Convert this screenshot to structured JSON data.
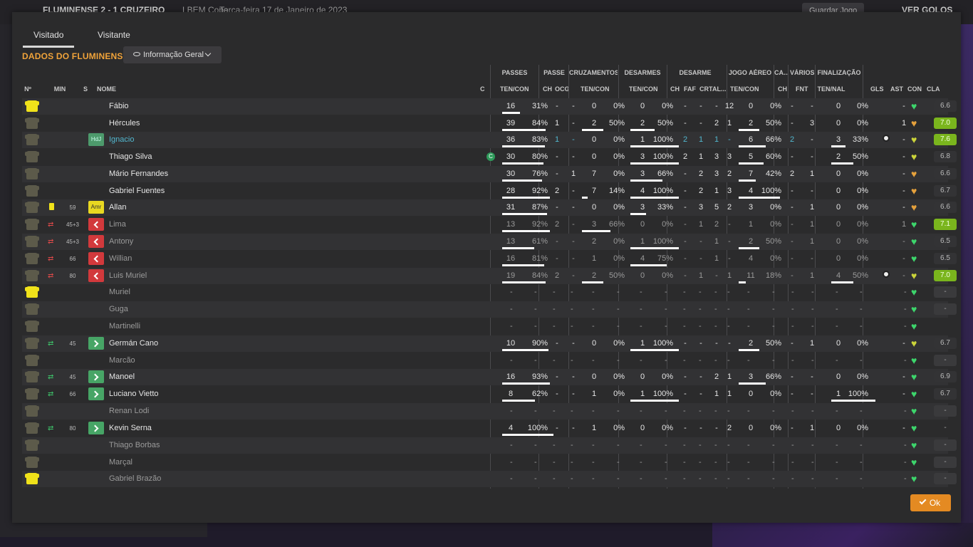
{
  "background": {
    "match": "FLUMINENSE 2 - 1 CRUZEIRO",
    "competition": "LBEM Copa",
    "date": "Terça-feira 17 de Janeiro de 2023",
    "save_label": "Guardar Jogo",
    "goals_label": "VER GOLOS"
  },
  "tabs": [
    "Visitado",
    "Visitante"
  ],
  "title": "DADOS DO FLUMINENSE",
  "dropdown": "Informação Geral",
  "groups": [
    "PASSES",
    "PASSE",
    "CRUZAMENTOS",
    "DESARMES",
    "DESARME",
    "JOGO AÉREO",
    "CA...",
    "VÁRIOS",
    "FINALIZAÇÃO"
  ],
  "subheaders": [
    "Nº",
    "MIN",
    "S",
    "NOME",
    "C",
    "TEN/CON",
    "CH",
    "OCG",
    "TEN/CON",
    "TEN/CON",
    "CH",
    "FAF",
    "CRT",
    "AL...",
    "TEN/CON",
    "CH",
    "FNT",
    "TEN/NAL",
    "GLS",
    "AST",
    "CON",
    "CLA"
  ],
  "ok_label": "Ok",
  "colors": {
    "accent": "#f0a33a",
    "ok": "#e48a22",
    "rating_good": "#7ab51d",
    "sub_out": "#d2393c",
    "sub_in": "#47a566"
  },
  "players": [
    {
      "name": "Fábio",
      "gk": true,
      "card": "",
      "sub": "",
      "min": "",
      "badge": "",
      "cap": "",
      "pass": [
        "16",
        "31%"
      ],
      "pbar": 0.31,
      "ch": "-",
      "ocg": "-",
      "cruz": [
        "0",
        "0%"
      ],
      "cbar": 0,
      "des": [
        "0",
        "0%"
      ],
      "dbar": 0,
      "d": [
        "-",
        "-",
        "-",
        "12"
      ],
      "aer": [
        "0",
        "0%"
      ],
      "abar": 0,
      "ca": "-",
      "fnt": "-",
      "fin": [
        "0",
        "0%"
      ],
      "fbar": 0,
      "gls": "",
      "ast": "-",
      "con": "green",
      "cla": "6.6",
      "clac": "gt",
      "dim": false
    },
    {
      "name": "Hércules",
      "gk": false,
      "card": "",
      "sub": "",
      "min": "",
      "badge": "",
      "cap": "",
      "pass": [
        "39",
        "84%"
      ],
      "pbar": 0.84,
      "ch": "1",
      "ocg": "-",
      "cruz": [
        "2",
        "50%"
      ],
      "cbar": 0.5,
      "des": [
        "2",
        "50%"
      ],
      "dbar": 0.5,
      "d": [
        "-",
        "-",
        "2",
        "1"
      ],
      "aer": [
        "2",
        "50%"
      ],
      "abar": 0.5,
      "ca": "-",
      "fnt": "3",
      "fin": [
        "0",
        "0%"
      ],
      "fbar": 0,
      "gls": "",
      "ast": "1",
      "con": "orange",
      "cla": "7.0",
      "clac": "g",
      "dim": false
    },
    {
      "name": "Ignacio",
      "gk": false,
      "card": "",
      "sub": "",
      "min": "",
      "badge": "HdJ",
      "cap": "",
      "pass": [
        "36",
        "83%"
      ],
      "pbar": 0.83,
      "ch": "1",
      "ocg": "-",
      "cruz": [
        "0",
        "0%"
      ],
      "cbar": 0,
      "des": [
        "1",
        "100%"
      ],
      "dbar": 1,
      "d": [
        "2",
        "1",
        "1",
        "-"
      ],
      "aer": [
        "6",
        "66%"
      ],
      "abar": 0.66,
      "ca": "2",
      "fnt": "-",
      "fin": [
        "3",
        "33%"
      ],
      "fbar": 0.33,
      "gls": "ball",
      "ast": "-",
      "con": "yellow",
      "cla": "7.6",
      "clac": "g",
      "dim": false,
      "hl": true
    },
    {
      "name": "Thiago Silva",
      "gk": false,
      "card": "",
      "sub": "",
      "min": "",
      "badge": "",
      "cap": "C",
      "pass": [
        "30",
        "80%"
      ],
      "pbar": 0.8,
      "ch": "-",
      "ocg": "-",
      "cruz": [
        "0",
        "0%"
      ],
      "cbar": 0,
      "des": [
        "3",
        "100%"
      ],
      "dbar": 1,
      "d": [
        "2",
        "1",
        "3",
        "3"
      ],
      "aer": [
        "5",
        "60%"
      ],
      "abar": 0.6,
      "ca": "-",
      "fnt": "-",
      "fin": [
        "2",
        "50%"
      ],
      "fbar": 0.5,
      "gls": "",
      "ast": "-",
      "con": "yellow",
      "cla": "6.8",
      "clac": "gt",
      "dim": false
    },
    {
      "name": "Mário Fernandes",
      "gk": false,
      "card": "",
      "sub": "",
      "min": "",
      "badge": "",
      "cap": "",
      "pass": [
        "30",
        "76%"
      ],
      "pbar": 0.76,
      "ch": "-",
      "ocg": "1",
      "cruz": [
        "7",
        "0%"
      ],
      "cbar": 0,
      "des": [
        "3",
        "66%"
      ],
      "dbar": 0.66,
      "d": [
        "-",
        "2",
        "3",
        "2"
      ],
      "aer": [
        "7",
        "42%"
      ],
      "abar": 0.42,
      "ca": "2",
      "fnt": "1",
      "fin": [
        "0",
        "0%"
      ],
      "fbar": 0,
      "gls": "",
      "ast": "-",
      "con": "orange",
      "cla": "6.6",
      "clac": "gt",
      "dim": false
    },
    {
      "name": "Gabriel Fuentes",
      "gk": false,
      "card": "",
      "sub": "",
      "min": "",
      "badge": "",
      "cap": "",
      "pass": [
        "28",
        "92%"
      ],
      "pbar": 0.92,
      "ch": "2",
      "ocg": "-",
      "cruz": [
        "7",
        "14%"
      ],
      "cbar": 0.14,
      "des": [
        "4",
        "100%"
      ],
      "dbar": 1,
      "d": [
        "-",
        "2",
        "1",
        "3"
      ],
      "aer": [
        "4",
        "100%"
      ],
      "abar": 1,
      "ca": "-",
      "fnt": "-",
      "fin": [
        "0",
        "0%"
      ],
      "fbar": 0,
      "gls": "",
      "ast": "-",
      "con": "orange",
      "cla": "6.7",
      "clac": "gt",
      "dim": false
    },
    {
      "name": "Allan",
      "gk": false,
      "card": "yellow",
      "sub": "",
      "min": "59",
      "badge": "Amr",
      "cap": "",
      "pass": [
        "31",
        "87%"
      ],
      "pbar": 0.87,
      "ch": "-",
      "ocg": "-",
      "cruz": [
        "0",
        "0%"
      ],
      "cbar": 0,
      "des": [
        "3",
        "33%"
      ],
      "dbar": 0.33,
      "d": [
        "-",
        "3",
        "5",
        "2"
      ],
      "aer": [
        "3",
        "0%"
      ],
      "abar": 0,
      "ca": "-",
      "fnt": "1",
      "fin": [
        "0",
        "0%"
      ],
      "fbar": 0,
      "gls": "",
      "ast": "-",
      "con": "orange",
      "cla": "6.6",
      "clac": "gt",
      "dim": false
    },
    {
      "name": "Lima",
      "gk": false,
      "card": "",
      "sub": "out",
      "min": "45+3",
      "badge": "out",
      "cap": "",
      "pass": [
        "13",
        "92%"
      ],
      "pbar": 0.92,
      "ch": "2",
      "ocg": "-",
      "cruz": [
        "3",
        "66%"
      ],
      "cbar": 0.66,
      "des": [
        "0",
        "0%"
      ],
      "dbar": 0,
      "d": [
        "-",
        "1",
        "2",
        "-"
      ],
      "aer": [
        "1",
        "0%"
      ],
      "abar": 0,
      "ca": "-",
      "fnt": "1",
      "fin": [
        "0",
        "0%"
      ],
      "fbar": 0,
      "gls": "",
      "ast": "1",
      "con": "green",
      "cla": "7.1",
      "clac": "g",
      "dim": true
    },
    {
      "name": "Antony",
      "gk": false,
      "card": "",
      "sub": "out",
      "min": "45+3",
      "badge": "out",
      "cap": "",
      "pass": [
        "13",
        "61%"
      ],
      "pbar": 0.61,
      "ch": "-",
      "ocg": "-",
      "cruz": [
        "2",
        "0%"
      ],
      "cbar": 0,
      "des": [
        "1",
        "100%"
      ],
      "dbar": 1,
      "d": [
        "-",
        "-",
        "1",
        "-"
      ],
      "aer": [
        "2",
        "50%"
      ],
      "abar": 0.5,
      "ca": "-",
      "fnt": "1",
      "fin": [
        "0",
        "0%"
      ],
      "fbar": 0,
      "gls": "",
      "ast": "-",
      "con": "green",
      "cla": "6.5",
      "clac": "gt",
      "dim": true
    },
    {
      "name": "Willian",
      "gk": false,
      "card": "",
      "sub": "out",
      "min": "66",
      "badge": "out",
      "cap": "",
      "pass": [
        "16",
        "81%"
      ],
      "pbar": 0.81,
      "ch": "-",
      "ocg": "-",
      "cruz": [
        "1",
        "0%"
      ],
      "cbar": 0,
      "des": [
        "4",
        "75%"
      ],
      "dbar": 0.75,
      "d": [
        "-",
        "-",
        "1",
        "-"
      ],
      "aer": [
        "4",
        "0%"
      ],
      "abar": 0,
      "ca": "-",
      "fnt": "-",
      "fin": [
        "0",
        "0%"
      ],
      "fbar": 0,
      "gls": "",
      "ast": "-",
      "con": "green",
      "cla": "6.5",
      "clac": "gt",
      "dim": true
    },
    {
      "name": "Luis Muriel",
      "gk": false,
      "card": "",
      "sub": "out",
      "min": "80",
      "badge": "out",
      "cap": "",
      "pass": [
        "19",
        "84%"
      ],
      "pbar": 0.84,
      "ch": "2",
      "ocg": "-",
      "cruz": [
        "2",
        "50%"
      ],
      "cbar": 0.5,
      "des": [
        "0",
        "0%"
      ],
      "dbar": 0,
      "d": [
        "-",
        "1",
        "-",
        "1"
      ],
      "aer": [
        "11",
        "18%"
      ],
      "abar": 0.18,
      "ca": "-",
      "fnt": "1",
      "fin": [
        "4",
        "50%"
      ],
      "fbar": 0.5,
      "gls": "ball",
      "ast": "-",
      "con": "yellow",
      "cla": "7.0",
      "clac": "g",
      "dim": true
    },
    {
      "name": "Muriel",
      "gk": true,
      "card": "",
      "sub": "",
      "min": "",
      "badge": "",
      "cap": "",
      "empty": true,
      "con": "green",
      "cla": "-",
      "dim": true
    },
    {
      "name": "Guga",
      "gk": false,
      "card": "",
      "sub": "",
      "min": "",
      "badge": "",
      "cap": "",
      "empty": true,
      "con": "green",
      "cla": "-",
      "dim": true
    },
    {
      "name": "Martinelli",
      "gk": false,
      "card": "",
      "sub": "",
      "min": "",
      "badge": "",
      "cap": "",
      "empty": true,
      "con": "green",
      "cla": "",
      "dim": true
    },
    {
      "name": "Germán Cano",
      "gk": false,
      "card": "",
      "sub": "in",
      "min": "45",
      "badge": "in",
      "cap": "",
      "pass": [
        "10",
        "90%"
      ],
      "pbar": 0.9,
      "ch": "-",
      "ocg": "-",
      "cruz": [
        "0",
        "0%"
      ],
      "cbar": 0,
      "des": [
        "1",
        "100%"
      ],
      "dbar": 1,
      "d": [
        "-",
        "-",
        "-",
        "-"
      ],
      "aer": [
        "2",
        "50%"
      ],
      "abar": 0.5,
      "ca": "-",
      "fnt": "1",
      "fin": [
        "0",
        "0%"
      ],
      "fbar": 0,
      "gls": "",
      "ast": "-",
      "con": "yellow",
      "cla": "6.7",
      "clac": "gt",
      "dim": false
    },
    {
      "name": "Marcão",
      "gk": false,
      "card": "",
      "sub": "",
      "min": "",
      "badge": "",
      "cap": "",
      "empty": true,
      "con": "green",
      "cla": "-",
      "dim": true
    },
    {
      "name": "Manoel",
      "gk": false,
      "card": "",
      "sub": "in",
      "min": "45",
      "badge": "in",
      "cap": "",
      "pass": [
        "16",
        "93%"
      ],
      "pbar": 0.93,
      "ch": "-",
      "ocg": "-",
      "cruz": [
        "0",
        "0%"
      ],
      "cbar": 0,
      "des": [
        "0",
        "0%"
      ],
      "dbar": 0,
      "d": [
        "-",
        "-",
        "2",
        "1"
      ],
      "aer": [
        "3",
        "66%"
      ],
      "abar": 0.66,
      "ca": "-",
      "fnt": "-",
      "fin": [
        "0",
        "0%"
      ],
      "fbar": 0,
      "gls": "",
      "ast": "-",
      "con": "green",
      "cla": "6.9",
      "clac": "gt",
      "dim": false
    },
    {
      "name": "Luciano Vietto",
      "gk": false,
      "card": "",
      "sub": "in",
      "min": "66",
      "badge": "in",
      "cap": "",
      "pass": [
        "8",
        "62%"
      ],
      "pbar": 0.62,
      "ch": "-",
      "ocg": "-",
      "cruz": [
        "1",
        "0%"
      ],
      "cbar": 0,
      "des": [
        "1",
        "100%"
      ],
      "dbar": 1,
      "d": [
        "-",
        "-",
        "1",
        "1"
      ],
      "aer": [
        "0",
        "0%"
      ],
      "abar": 0,
      "ca": "-",
      "fnt": "-",
      "fin": [
        "1",
        "100%"
      ],
      "fbar": 1,
      "gls": "",
      "ast": "-",
      "con": "green",
      "cla": "6.7",
      "clac": "gt",
      "dim": false
    },
    {
      "name": "Renan Lodi",
      "gk": false,
      "card": "",
      "sub": "",
      "min": "",
      "badge": "",
      "cap": "",
      "empty": true,
      "con": "green",
      "cla": "-",
      "dim": true
    },
    {
      "name": "Kevin Serna",
      "gk": false,
      "card": "",
      "sub": "in",
      "min": "80",
      "badge": "in",
      "cap": "",
      "pass": [
        "4",
        "100%"
      ],
      "pbar": 1,
      "ch": "-",
      "ocg": "-",
      "cruz": [
        "1",
        "0%"
      ],
      "cbar": 0,
      "des": [
        "0",
        "0%"
      ],
      "dbar": 0,
      "d": [
        "-",
        "-",
        "-",
        "2"
      ],
      "aer": [
        "0",
        "0%"
      ],
      "abar": 0,
      "ca": "-",
      "fnt": "1",
      "fin": [
        "0",
        "0%"
      ],
      "fbar": 0,
      "gls": "",
      "ast": "-",
      "con": "green",
      "cla": "-",
      "clac": "none",
      "dim": false
    },
    {
      "name": "Thiago Borbas",
      "gk": false,
      "card": "",
      "sub": "",
      "min": "",
      "badge": "",
      "cap": "",
      "empty": true,
      "con": "green",
      "cla": "-",
      "dim": true
    },
    {
      "name": "Marçal",
      "gk": false,
      "card": "",
      "sub": "",
      "min": "",
      "badge": "",
      "cap": "",
      "empty": true,
      "con": "green",
      "cla": "-",
      "dim": true
    },
    {
      "name": "Gabriel Brazão",
      "gk": true,
      "card": "",
      "sub": "",
      "min": "",
      "badge": "",
      "cap": "",
      "empty": true,
      "con": "green",
      "cla": "-",
      "dim": true
    }
  ]
}
